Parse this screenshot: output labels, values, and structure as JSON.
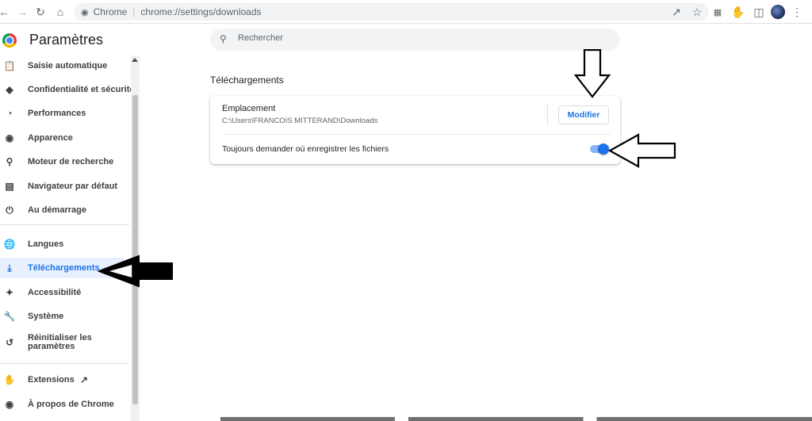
{
  "toolbar": {
    "site_name": "Chrome",
    "url": "chrome://settings/downloads"
  },
  "sidebar": {
    "title": "Paramètres",
    "items": [
      {
        "label": "Saisie automatique",
        "icon": "clipboard-icon"
      },
      {
        "label": "Confidentialité et sécurité",
        "icon": "shield-icon"
      },
      {
        "label": "Performances",
        "icon": "speedometer-icon"
      },
      {
        "label": "Apparence",
        "icon": "palette-icon"
      },
      {
        "label": "Moteur de recherche",
        "icon": "search-icon"
      },
      {
        "label": "Navigateur par défaut",
        "icon": "browser-icon"
      },
      {
        "label": "Au démarrage",
        "icon": "power-icon"
      },
      {
        "label": "Langues",
        "icon": "globe-icon"
      },
      {
        "label": "Téléchargements",
        "icon": "download-icon",
        "active": true
      },
      {
        "label": "Accessibilité",
        "icon": "accessibility-icon"
      },
      {
        "label": "Système",
        "icon": "wrench-icon"
      },
      {
        "label": "Réinitialiser les paramètres",
        "icon": "reset-icon"
      },
      {
        "label": "Extensions",
        "icon": "puzzle-icon"
      },
      {
        "label": "À propos de Chrome",
        "icon": "chrome-icon"
      }
    ]
  },
  "search": {
    "placeholder": "Rechercher"
  },
  "downloads": {
    "section_title": "Téléchargements",
    "location_label": "Emplacement",
    "location_path": "C:\\Users\\FRANCOIS MITTERAND\\Downloads",
    "modify_button": "Modifier",
    "ask_label": "Toujours demander où enregistrer les fichiers",
    "ask_enabled": true
  },
  "colors": {
    "accent": "#1a73e8",
    "active_bg": "#e8f0fe",
    "toggle_track": "#8ab4f8"
  }
}
